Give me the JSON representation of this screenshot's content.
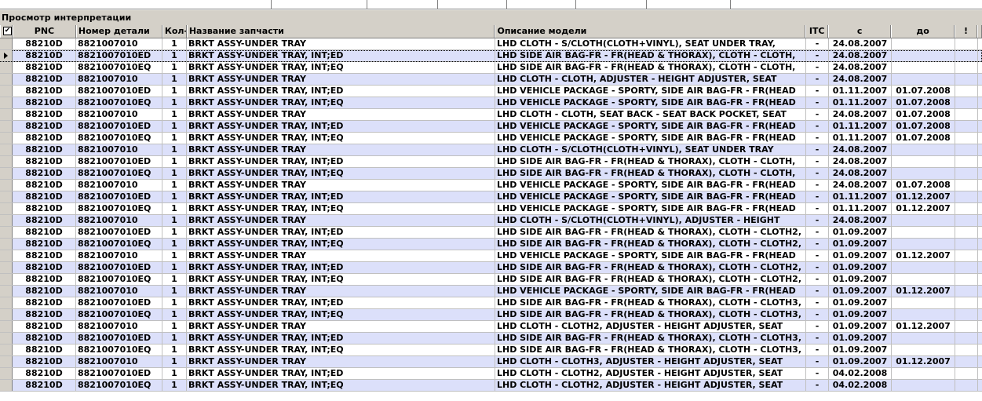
{
  "panel": {
    "title": "Просмотр интерпретации"
  },
  "columns": [
    "PNC",
    "Номер детали",
    "Кол-",
    "Название запчасти",
    "Описание модели",
    "ITC",
    "с",
    "до",
    "!"
  ],
  "header_check": "✔",
  "rows": [
    [
      "88210D",
      "8821007010",
      "1",
      "BRKT ASSY-UNDER TRAY",
      "LHD CLOTH - S/CLOTH(CLOTH+VINYL), SEAT UNDER TRAY,",
      "-",
      "24.08.2007",
      ""
    ],
    [
      "88210D",
      "8821007010ED",
      "1",
      "BRKT ASSY-UNDER TRAY, INT;ED",
      "LHD SIDE AIR BAG-FR - FR(HEAD & THORAX), CLOTH - CLOTH,",
      "-",
      "24.08.2007",
      ""
    ],
    [
      "88210D",
      "8821007010EQ",
      "1",
      "BRKT ASSY-UNDER TRAY, INT;EQ",
      "LHD SIDE AIR BAG-FR - FR(HEAD & THORAX), CLOTH - CLOTH,",
      "-",
      "24.08.2007",
      ""
    ],
    [
      "88210D",
      "8821007010",
      "1",
      "BRKT ASSY-UNDER TRAY",
      "LHD CLOTH - CLOTH, ADJUSTER - HEIGHT ADJUSTER, SEAT",
      "-",
      "24.08.2007",
      ""
    ],
    [
      "88210D",
      "8821007010ED",
      "1",
      "BRKT ASSY-UNDER TRAY, INT;ED",
      "LHD VEHICLE PACKAGE - SPORTY, SIDE AIR BAG-FR - FR(HEAD",
      "-",
      "01.11.2007",
      "01.07.2008"
    ],
    [
      "88210D",
      "8821007010EQ",
      "1",
      "BRKT ASSY-UNDER TRAY, INT;EQ",
      "LHD VEHICLE PACKAGE - SPORTY, SIDE AIR BAG-FR - FR(HEAD",
      "-",
      "01.11.2007",
      "01.07.2008"
    ],
    [
      "88210D",
      "8821007010",
      "1",
      "BRKT ASSY-UNDER TRAY",
      "LHD CLOTH - CLOTH, SEAT BACK - SEAT BACK POCKET, SEAT",
      "-",
      "24.08.2007",
      "01.07.2008"
    ],
    [
      "88210D",
      "8821007010ED",
      "1",
      "BRKT ASSY-UNDER TRAY, INT;ED",
      "LHD VEHICLE PACKAGE - SPORTY, SIDE AIR BAG-FR - FR(HEAD",
      "-",
      "01.11.2007",
      "01.07.2008"
    ],
    [
      "88210D",
      "8821007010EQ",
      "1",
      "BRKT ASSY-UNDER TRAY, INT;EQ",
      "LHD VEHICLE PACKAGE - SPORTY, SIDE AIR BAG-FR - FR(HEAD",
      "-",
      "01.11.2007",
      "01.07.2008"
    ],
    [
      "88210D",
      "8821007010",
      "1",
      "BRKT ASSY-UNDER TRAY",
      "LHD CLOTH - S/CLOTH(CLOTH+VINYL), SEAT UNDER TRAY",
      "-",
      "24.08.2007",
      ""
    ],
    [
      "88210D",
      "8821007010ED",
      "1",
      "BRKT ASSY-UNDER TRAY, INT;ED",
      "LHD SIDE AIR BAG-FR - FR(HEAD & THORAX), CLOTH - CLOTH,",
      "-",
      "24.08.2007",
      ""
    ],
    [
      "88210D",
      "8821007010EQ",
      "1",
      "BRKT ASSY-UNDER TRAY, INT;EQ",
      "LHD SIDE AIR BAG-FR - FR(HEAD & THORAX), CLOTH - CLOTH,",
      "-",
      "24.08.2007",
      ""
    ],
    [
      "88210D",
      "8821007010",
      "1",
      "BRKT ASSY-UNDER TRAY",
      "LHD VEHICLE PACKAGE - SPORTY, SIDE AIR BAG-FR - FR(HEAD",
      "-",
      "24.08.2007",
      "01.07.2008"
    ],
    [
      "88210D",
      "8821007010ED",
      "1",
      "BRKT ASSY-UNDER TRAY, INT;ED",
      "LHD VEHICLE PACKAGE - SPORTY, SIDE AIR BAG-FR - FR(HEAD",
      "-",
      "01.11.2007",
      "01.12.2007"
    ],
    [
      "88210D",
      "8821007010EQ",
      "1",
      "BRKT ASSY-UNDER TRAY, INT;EQ",
      "LHD VEHICLE PACKAGE - SPORTY, SIDE AIR BAG-FR - FR(HEAD",
      "-",
      "01.11.2007",
      "01.12.2007"
    ],
    [
      "88210D",
      "8821007010",
      "1",
      "BRKT ASSY-UNDER TRAY",
      "LHD CLOTH - S/CLOTH(CLOTH+VINYL), ADJUSTER - HEIGHT",
      "-",
      "24.08.2007",
      ""
    ],
    [
      "88210D",
      "8821007010ED",
      "1",
      "BRKT ASSY-UNDER TRAY, INT;ED",
      "LHD SIDE AIR BAG-FR - FR(HEAD & THORAX), CLOTH - CLOTH2,",
      "-",
      "01.09.2007",
      ""
    ],
    [
      "88210D",
      "8821007010EQ",
      "1",
      "BRKT ASSY-UNDER TRAY, INT;EQ",
      "LHD SIDE AIR BAG-FR - FR(HEAD & THORAX), CLOTH - CLOTH2,",
      "-",
      "01.09.2007",
      ""
    ],
    [
      "88210D",
      "8821007010",
      "1",
      "BRKT ASSY-UNDER TRAY",
      "LHD VEHICLE PACKAGE - SPORTY, SIDE AIR BAG-FR - FR(HEAD",
      "-",
      "01.09.2007",
      "01.12.2007"
    ],
    [
      "88210D",
      "8821007010ED",
      "1",
      "BRKT ASSY-UNDER TRAY, INT;ED",
      "LHD SIDE AIR BAG-FR - FR(HEAD & THORAX), CLOTH - CLOTH2,",
      "-",
      "01.09.2007",
      ""
    ],
    [
      "88210D",
      "8821007010EQ",
      "1",
      "BRKT ASSY-UNDER TRAY, INT;EQ",
      "LHD SIDE AIR BAG-FR - FR(HEAD & THORAX), CLOTH - CLOTH2,",
      "-",
      "01.09.2007",
      ""
    ],
    [
      "88210D",
      "8821007010",
      "1",
      "BRKT ASSY-UNDER TRAY",
      "LHD VEHICLE PACKAGE - SPORTY, SIDE AIR BAG-FR - FR(HEAD",
      "-",
      "01.09.2007",
      "01.12.2007"
    ],
    [
      "88210D",
      "8821007010ED",
      "1",
      "BRKT ASSY-UNDER TRAY, INT;ED",
      "LHD SIDE AIR BAG-FR - FR(HEAD & THORAX), CLOTH - CLOTH3,",
      "-",
      "01.09.2007",
      ""
    ],
    [
      "88210D",
      "8821007010EQ",
      "1",
      "BRKT ASSY-UNDER TRAY, INT;EQ",
      "LHD SIDE AIR BAG-FR - FR(HEAD & THORAX), CLOTH - CLOTH3,",
      "-",
      "01.09.2007",
      ""
    ],
    [
      "88210D",
      "8821007010",
      "1",
      "BRKT ASSY-UNDER TRAY",
      "LHD CLOTH - CLOTH2, ADJUSTER - HEIGHT ADJUSTER, SEAT",
      "-",
      "01.09.2007",
      "01.12.2007"
    ],
    [
      "88210D",
      "8821007010ED",
      "1",
      "BRKT ASSY-UNDER TRAY, INT;ED",
      "LHD SIDE AIR BAG-FR - FR(HEAD & THORAX), CLOTH - CLOTH3,",
      "-",
      "01.09.2007",
      ""
    ],
    [
      "88210D",
      "8821007010EQ",
      "1",
      "BRKT ASSY-UNDER TRAY, INT;EQ",
      "LHD SIDE AIR BAG-FR - FR(HEAD & THORAX), CLOTH - CLOTH3,",
      "-",
      "01.09.2007",
      ""
    ],
    [
      "88210D",
      "8821007010",
      "1",
      "BRKT ASSY-UNDER TRAY",
      "LHD CLOTH - CLOTH3, ADJUSTER - HEIGHT ADJUSTER, SEAT",
      "-",
      "01.09.2007",
      "01.12.2007"
    ],
    [
      "88210D",
      "8821007010ED",
      "1",
      "BRKT ASSY-UNDER TRAY, INT;ED",
      "LHD CLOTH - CLOTH2, ADJUSTER - HEIGHT ADJUSTER, SEAT",
      "-",
      "04.02.2008",
      ""
    ],
    [
      "88210D",
      "8821007010EQ",
      "1",
      "BRKT ASSY-UNDER TRAY, INT;EQ",
      "LHD CLOTH - CLOTH2, ADJUSTER - HEIGHT ADJUSTER, SEAT",
      "-",
      "04.02.2008",
      ""
    ]
  ],
  "current_row_index": 1,
  "colors": {
    "row_alt": "#dce0fa",
    "header_bg": "#d4d0c8",
    "grid_line": "#c0c0c0"
  }
}
